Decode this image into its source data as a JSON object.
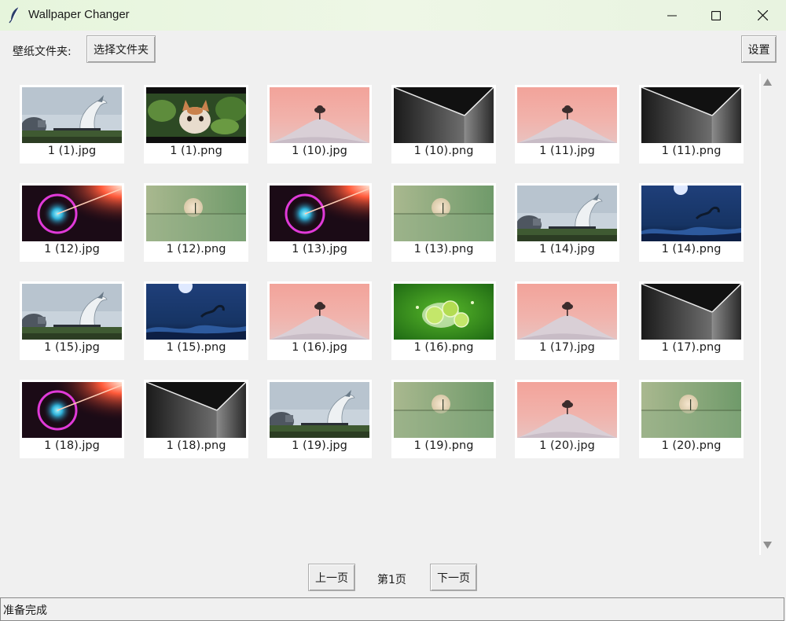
{
  "window": {
    "title": "Wallpaper Changer",
    "icon": "feather-icon"
  },
  "toolbar": {
    "folder_label": "壁纸文件夹:",
    "choose_folder_button": "选择文件夹",
    "settings_button": "设置"
  },
  "thumbnails": [
    {
      "name": "1 (1).jpg",
      "image": "dragon-landscape"
    },
    {
      "name": "1 (1).png",
      "image": "cat-in-leaves"
    },
    {
      "name": "1 (10).jpg",
      "image": "pink-sky-tree-hill"
    },
    {
      "name": "1 (10).png",
      "image": "dark-corner-light"
    },
    {
      "name": "1 (11).jpg",
      "image": "pink-sky-tree-hill"
    },
    {
      "name": "1 (11).png",
      "image": "dark-corner-light"
    },
    {
      "name": "1 (12).jpg",
      "image": "neon-orb"
    },
    {
      "name": "1 (12).png",
      "image": "green-moon-horizon"
    },
    {
      "name": "1 (13).jpg",
      "image": "neon-orb"
    },
    {
      "name": "1 (13).png",
      "image": "green-moon-horizon"
    },
    {
      "name": "1 (14).jpg",
      "image": "dragon-landscape"
    },
    {
      "name": "1 (14).png",
      "image": "blue-night-dragon"
    },
    {
      "name": "1 (15).jpg",
      "image": "dragon-landscape"
    },
    {
      "name": "1 (15).png",
      "image": "blue-night-dragon"
    },
    {
      "name": "1 (16).jpg",
      "image": "pink-sky-tree-hill"
    },
    {
      "name": "1 (16).png",
      "image": "lime-splash"
    },
    {
      "name": "1 (17).jpg",
      "image": "pink-sky-tree-hill"
    },
    {
      "name": "1 (17).png",
      "image": "dark-corner-light"
    },
    {
      "name": "1 (18).jpg",
      "image": "neon-orb"
    },
    {
      "name": "1 (18).png",
      "image": "dark-corner-light"
    },
    {
      "name": "1 (19).jpg",
      "image": "dragon-landscape"
    },
    {
      "name": "1 (19).png",
      "image": "green-moon-horizon"
    },
    {
      "name": "1 (20).jpg",
      "image": "pink-sky-tree-hill"
    },
    {
      "name": "1 (20).png",
      "image": "green-moon-horizon"
    }
  ],
  "pagination": {
    "prev_button": "上一页",
    "page_label": "第1页",
    "next_button": "下一页"
  },
  "status": {
    "text": "准备完成"
  }
}
